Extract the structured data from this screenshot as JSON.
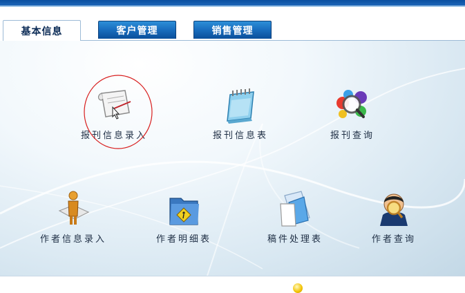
{
  "tabs": [
    {
      "label": "基本信息",
      "active": true
    },
    {
      "label": "客户管理",
      "active": false
    },
    {
      "label": "销售管理",
      "active": false
    }
  ],
  "items": [
    {
      "label": "报刊信息录入",
      "icon": "paper-scroll-icon"
    },
    {
      "label": "报刊信息表",
      "icon": "notepad-icon"
    },
    {
      "label": "报刊查询",
      "icon": "magnifier-search-icon"
    },
    {
      "label": "作者信息录入",
      "icon": "person-document-icon"
    },
    {
      "label": "作者明细表",
      "icon": "folder-icon"
    },
    {
      "label": "稿件处理表",
      "icon": "documents-icon"
    },
    {
      "label": "作者查询",
      "icon": "person-magnifier-icon"
    }
  ],
  "colors": {
    "topbar": "#0a4fa0",
    "tab_active_text": "#0a2a55",
    "tab_inactive_bg": "#1a6fc0",
    "highlight_circle": "#d81e1e"
  },
  "footer": {
    "text": ""
  }
}
